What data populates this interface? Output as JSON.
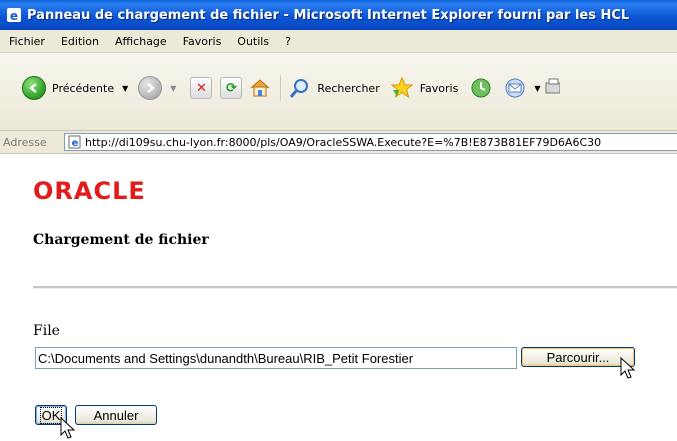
{
  "window": {
    "title": "Panneau de chargement de fichier - Microsoft Internet Explorer fourni par les HCL"
  },
  "menu": [
    "Fichier",
    "Edition",
    "Affichage",
    "Favoris",
    "Outils",
    "?"
  ],
  "toolbar": {
    "back_label": "Précédente",
    "search_label": "Rechercher",
    "favorites_label": "Favoris"
  },
  "address": {
    "label": "Adresse",
    "url": "http://di109su.chu-lyon.fr:8000/pls/OA9/OracleSSWA.Execute?E=%7B!E873B81EF79D6A6C30"
  },
  "page": {
    "logo": "ORACLE",
    "heading": "Chargement de fichier",
    "file_label": "File",
    "file_value": "C:\\Documents and Settings\\dunandth\\Bureau\\RIB_Petit Forestier",
    "browse_label": "Parcourir...",
    "ok_label": "OK",
    "cancel_label": "Annuler"
  },
  "colors": {
    "titlebar": "#0b57d6",
    "chrome": "#ece9d8",
    "oracle_red": "#e21b1b"
  }
}
